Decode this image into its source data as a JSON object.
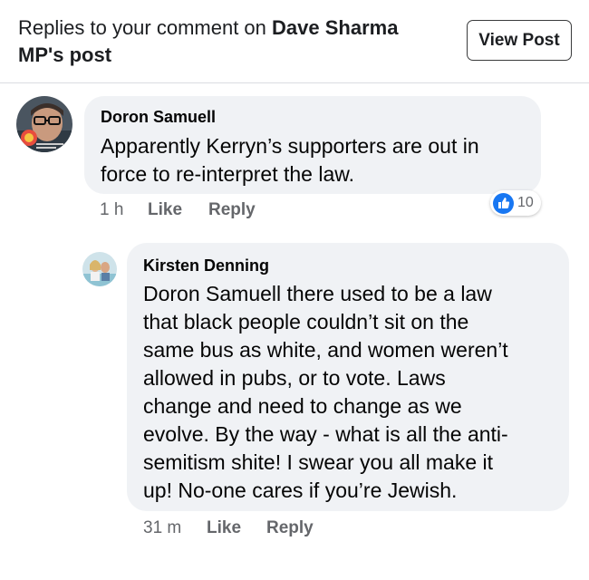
{
  "header": {
    "title_prefix": "Replies to your comment on ",
    "title_author": "Dave Sharma MP's post",
    "view_post_label": "View Post"
  },
  "comments": [
    {
      "author": "Doron Samuell",
      "text": "Apparently Kerryn’s supporters are out in\nforce to re-interpret the law.",
      "time": "1 h",
      "like_label": "Like",
      "reply_label": "Reply",
      "reaction_icon": "thumbs-up-icon",
      "reaction_count": "10"
    },
    {
      "author": "Kirsten Denning",
      "text": "Doron Samuell there used to be a law\nthat black people couldn’t sit on the\nsame bus as white, and women weren’t\nallowed in pubs, or to vote. Laws\nchange and need to change as we\nevolve. By the way - what is all the anti-\nsemitism shite! I swear you all make it\nup! No-one cares if you’re Jewish.",
      "time": "31 m",
      "like_label": "Like",
      "reply_label": "Reply"
    }
  ],
  "colors": {
    "bubble": "#f0f2f5",
    "meta_text": "#65676b",
    "like_blue": "#1877f2",
    "divider": "#dadde1"
  }
}
